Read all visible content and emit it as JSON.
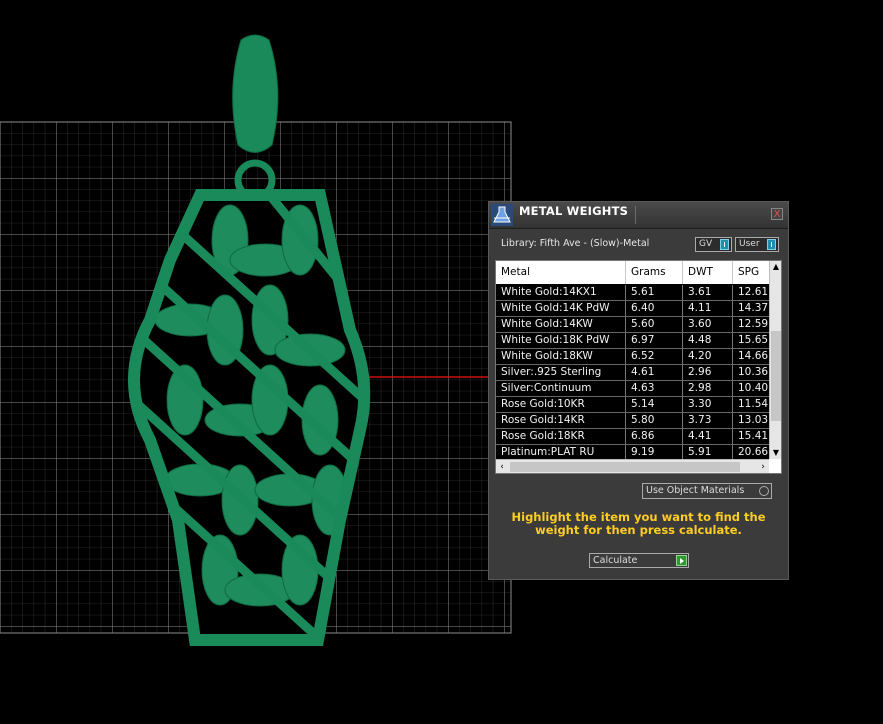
{
  "window": {
    "title": "METAL WEIGHTS",
    "close_label": "X"
  },
  "library": {
    "label": "Library: Fifth Ave - (Slow)-Metal",
    "gv_label": "GV",
    "user_label": "User"
  },
  "table": {
    "headers": [
      "Metal",
      "Grams",
      "DWT",
      "SPG"
    ],
    "rows": [
      [
        "White Gold:14KX1",
        "5.61",
        "3.61",
        "12.61"
      ],
      [
        "White Gold:14K PdW",
        "6.40",
        "4.11",
        "14.37"
      ],
      [
        "White Gold:14KW",
        "5.60",
        "3.60",
        "12.59"
      ],
      [
        "White Gold:18K PdW",
        "6.97",
        "4.48",
        "15.65"
      ],
      [
        "White Gold:18KW",
        "6.52",
        "4.20",
        "14.66"
      ],
      [
        "Silver:.925 Sterling",
        "4.61",
        "2.96",
        "10.36"
      ],
      [
        "Silver:Continuum",
        "4.63",
        "2.98",
        "10.40"
      ],
      [
        "Rose Gold:10KR",
        "5.14",
        "3.30",
        "11.54"
      ],
      [
        "Rose Gold:14KR",
        "5.80",
        "3.73",
        "13.03"
      ],
      [
        "Rose Gold:18KR",
        "6.86",
        "4.41",
        "15.41"
      ],
      [
        "Platinum:PLAT RU",
        "9.19",
        "5.91",
        "20.66"
      ]
    ]
  },
  "options": {
    "use_object_materials": "Use Object Materials"
  },
  "hint": "Highlight the item you want to find the weight for then press calculate.",
  "calculate_label": "Calculate",
  "colors": {
    "model_green": "#1a8a5a",
    "grid": "#8c8c8c",
    "axis_red": "#cc1111",
    "hint_yellow": "#ffcc22"
  }
}
